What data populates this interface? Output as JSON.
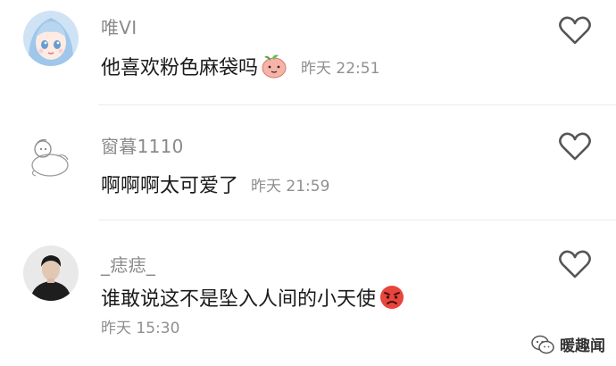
{
  "comments": [
    {
      "username": "唯VI",
      "text": "他喜欢粉色麻袋吗",
      "time": "昨天 22:51",
      "avatar": "anime-girl-avatar",
      "emoji": "peach-emoji"
    },
    {
      "username": "窗暮1110",
      "text": "啊啊啊太可爱了",
      "time": "昨天 21:59",
      "avatar": "sketch-character-avatar"
    },
    {
      "username": "_痣痣_",
      "text": "谁敢说这不是坠入人间的小天使",
      "time": "昨天 15:30",
      "avatar": "person-photo-avatar",
      "emoji": "angry-face-emoji"
    }
  ],
  "watermark": {
    "label": "暖趣闻",
    "icon": "wechat-icon"
  },
  "colors": {
    "username": "#8a8a8a",
    "text": "#1a1a1a",
    "time": "#8f8f8f",
    "divider": "#ececec"
  }
}
